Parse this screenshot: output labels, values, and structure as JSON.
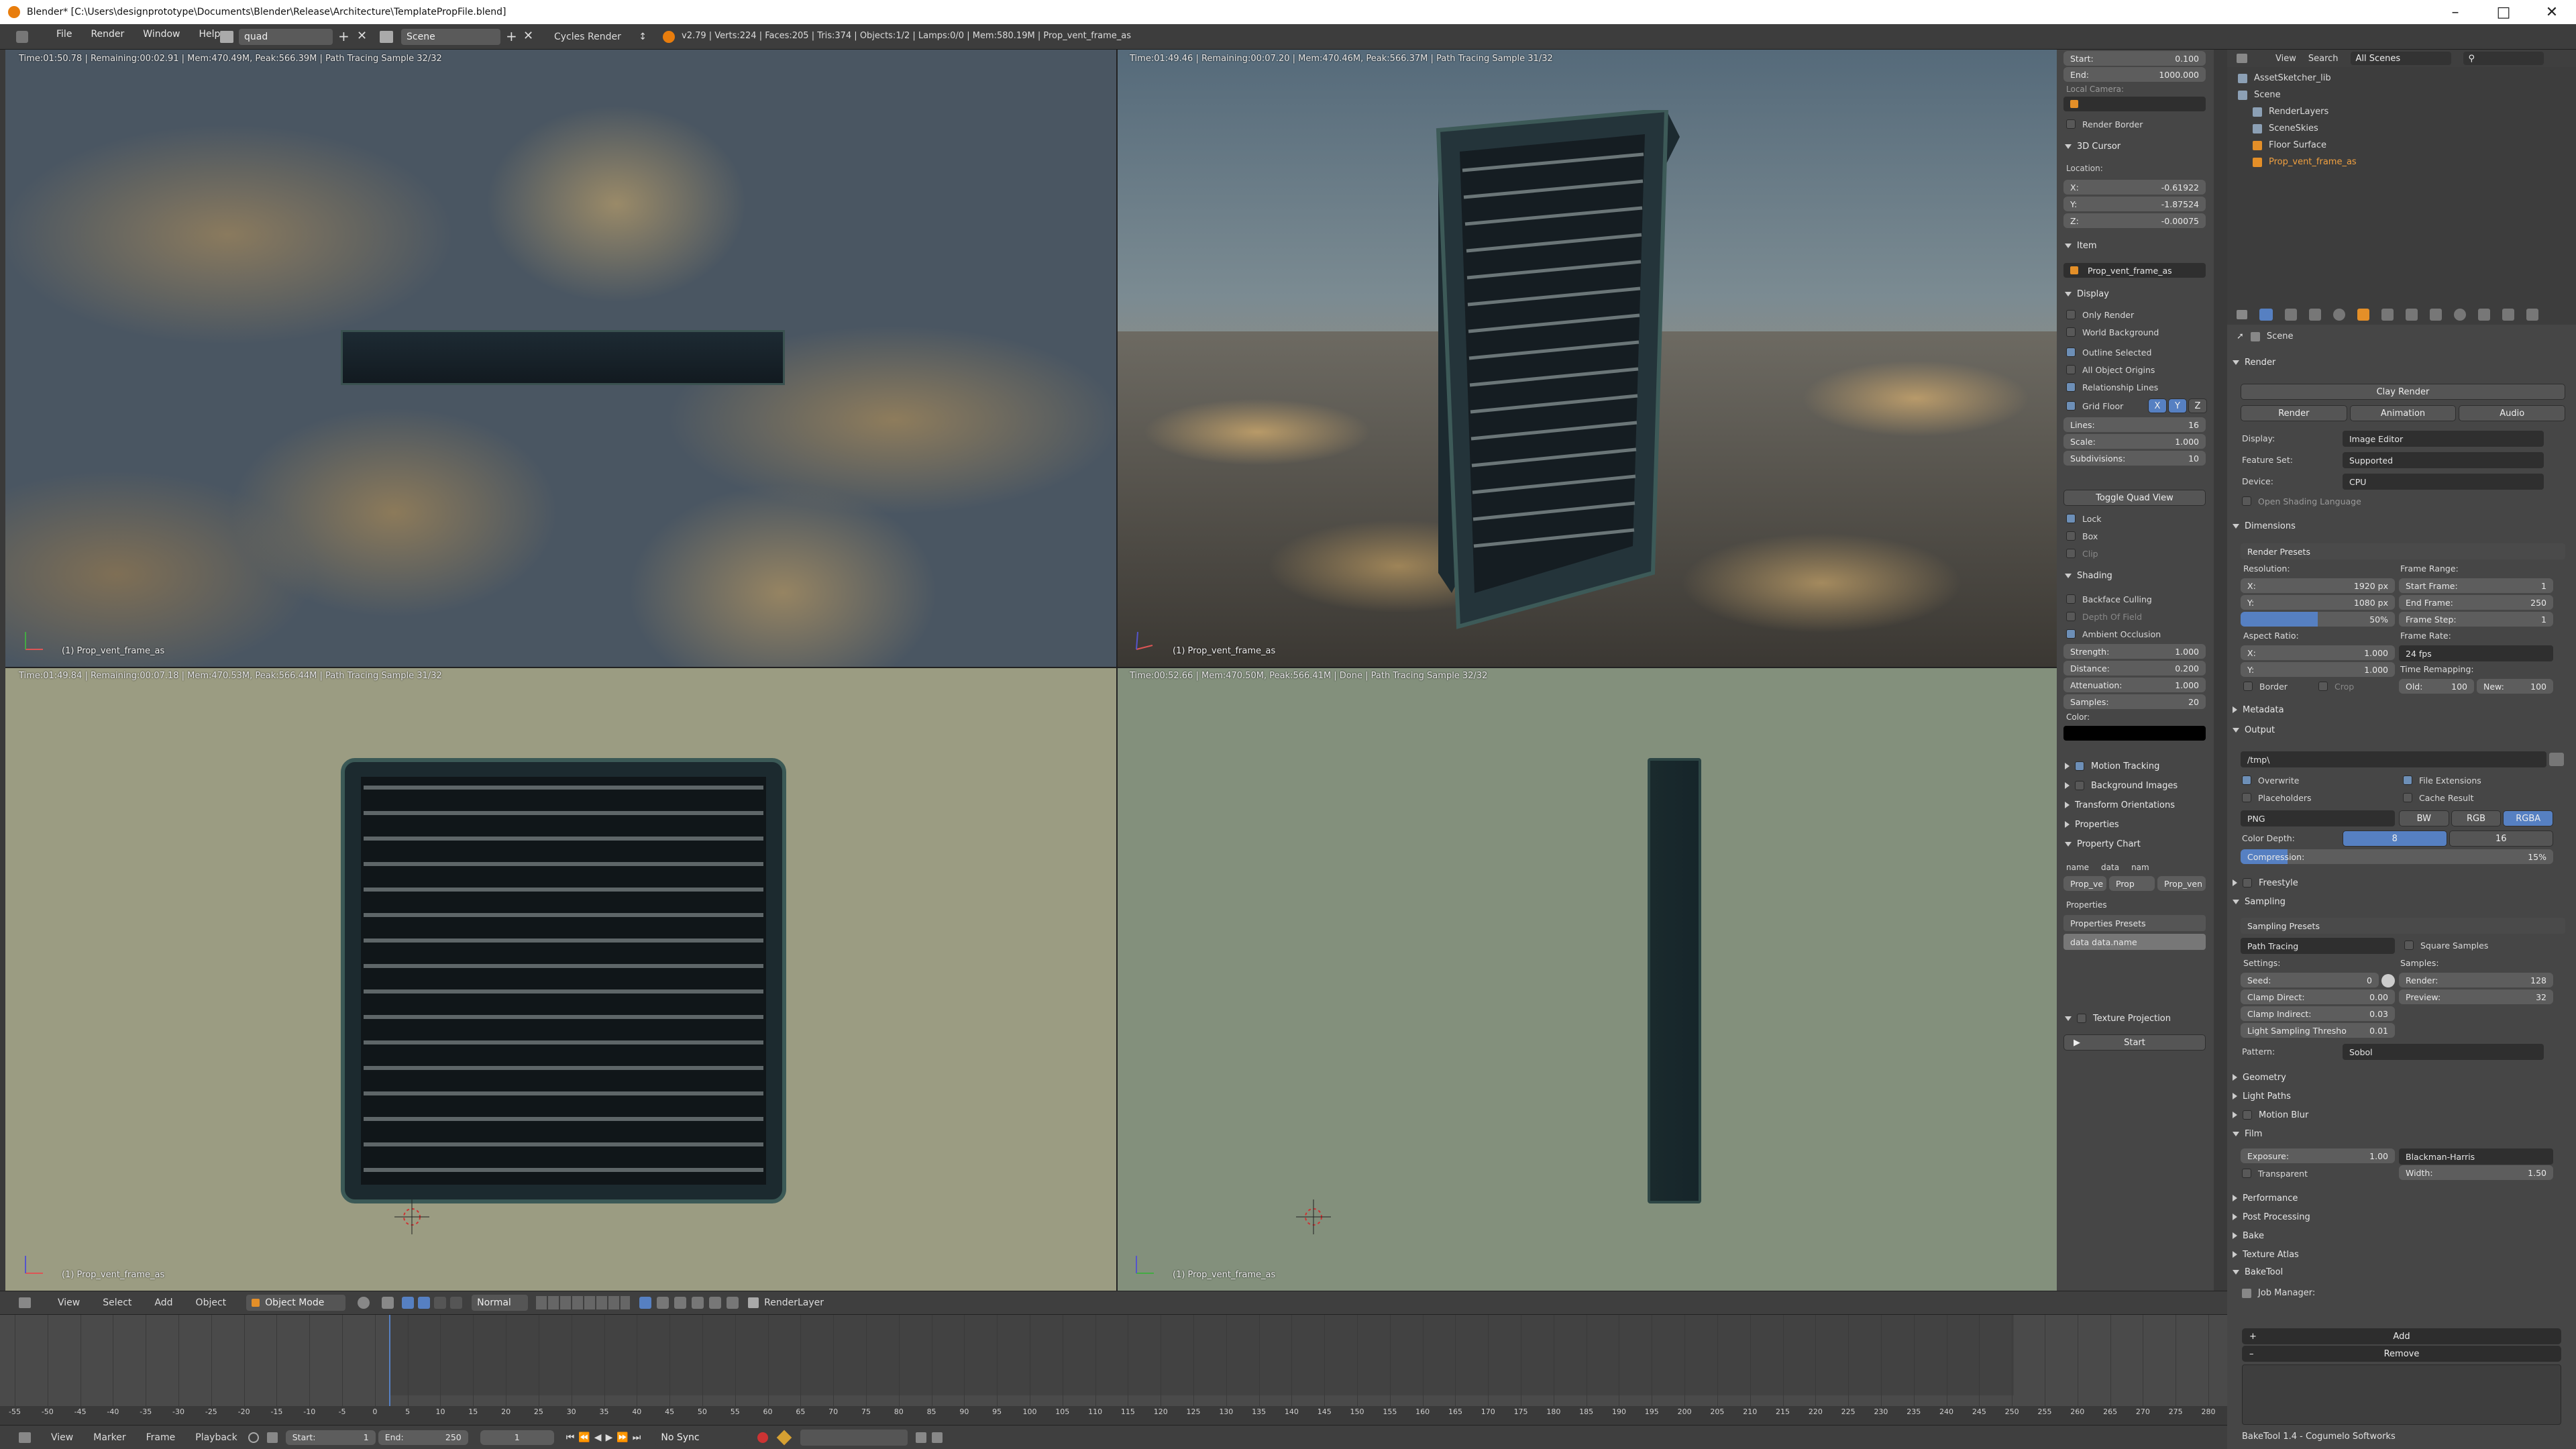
{
  "window": {
    "title": "Blender* [C:\\Users\\designprototype\\Documents\\Blender\\Release\\Architecture\\TemplatePropFile.blend]",
    "controls": [
      "minimize-icon",
      "maximize-icon",
      "close-icon"
    ]
  },
  "infobar": {
    "menus": [
      "File",
      "Render",
      "Window",
      "Help"
    ],
    "layout": "quad",
    "scene": "Scene",
    "engine": "Cycles Render",
    "stats": "v2.79 | Verts:224 | Faces:205 | Tris:374 | Objects:1/2 | Lamps:0/0 | Mem:580.19M | Prop_vent_frame_as"
  },
  "viewports": [
    {
      "status": "Time:01:50.78 | Remaining:00:02.91 | Mem:470.49M, Peak:566.39M | Path Tracing Sample 32/32",
      "label": "(1) Prop_vent_frame_as"
    },
    {
      "status": "Time:01:49.46 | Remaining:00:07.20 | Mem:470.46M, Peak:566.37M | Path Tracing Sample 31/32",
      "label": "(1) Prop_vent_frame_as"
    },
    {
      "status": "Time:01:49.84 | Remaining:00:07.18 | Mem:470.53M, Peak:566.44M | Path Tracing Sample 31/32",
      "label": "(1) Prop_vent_frame_as"
    },
    {
      "status": "Time:00:52.66 | Mem:470.50M, Peak:566.41M | Done | Path Tracing Sample 32/32",
      "label": "(1) Prop_vent_frame_as"
    }
  ],
  "nprops": {
    "start_label": "Start:",
    "start_val": "0.100",
    "end_label": "End:",
    "end_val": "1000.000",
    "local_camera": "Local Camera:",
    "render_border": "Render Border",
    "cursor_head": "3D Cursor",
    "location": "Location:",
    "cx": "X:",
    "cx_val": "-0.61922",
    "cy": "Y:",
    "cy_val": "-1.87524",
    "cz": "Z:",
    "cz_val": "-0.00075",
    "item_head": "Item",
    "item_name": "Prop_vent_frame_as",
    "display_head": "Display",
    "only_render": "Only Render",
    "world_bg": "World Background",
    "outline_sel": "Outline Selected",
    "all_origins": "All Object Origins",
    "rel_lines": "Relationship Lines",
    "grid_floor": "Grid Floor",
    "gx": "X",
    "gy": "Y",
    "gz": "Z",
    "lines": "Lines:",
    "lines_val": "16",
    "scale": "Scale:",
    "scale_val": "1.000",
    "subdiv": "Subdivisions:",
    "subdiv_val": "10",
    "toggle_quad": "Toggle Quad View",
    "lock": "Lock",
    "box": "Box",
    "clip": "Clip",
    "shading_head": "Shading",
    "backface": "Backface Culling",
    "dof": "Depth Of Field",
    "ao": "Ambient Occlusion",
    "strength": "Strength:",
    "strength_val": "1.000",
    "distance": "Distance:",
    "distance_val": "0.200",
    "attenuation": "Attenuation:",
    "attenuation_val": "1.000",
    "samples": "Samples:",
    "samples_val": "20",
    "color": "Color:",
    "motion_tracking": "Motion Tracking",
    "bg_images": "Background Images",
    "transform_orient": "Transform Orientations",
    "properties": "Properties",
    "prop_chart": "Property Chart",
    "pc_name": "name",
    "pc_data": "data",
    "pc_nam": "nam",
    "pc_v1": "Prop_ve",
    "pc_v2": "Prop",
    "pc_v3": "Prop_ven",
    "properties2": "Properties",
    "prop_presets": "Properties Presets",
    "data_name": "data data.name",
    "tex_proj": "Texture Projection",
    "start_btn": "Start"
  },
  "outliner": {
    "view": "View",
    "search": "Search",
    "scenes": "All Scenes",
    "items": [
      {
        "label": "AssetSketcher_lib",
        "indent": 0,
        "icon": "library-icon"
      },
      {
        "label": "Scene",
        "indent": 0,
        "icon": "scene-icon"
      },
      {
        "label": "RenderLayers",
        "indent": 1,
        "icon": "renderlayers-icon"
      },
      {
        "label": "SceneSkies",
        "indent": 1,
        "icon": "world-icon"
      },
      {
        "label": "Floor Surface",
        "indent": 1,
        "icon": "mesh-icon"
      },
      {
        "label": "Prop_vent_frame_as",
        "indent": 1,
        "icon": "mesh-icon"
      }
    ]
  },
  "props": {
    "scene": "Scene",
    "render_head": "Render",
    "clay_render": "Clay Render",
    "render_btn": "Render",
    "animation_btn": "Animation",
    "audio_btn": "Audio",
    "display": "Display:",
    "display_val": "Image Editor",
    "feature_set": "Feature Set:",
    "feature_set_val": "Supported",
    "device": "Device:",
    "device_val": "CPU",
    "osl": "Open Shading Language",
    "dimensions_head": "Dimensions",
    "render_presets": "Render Presets",
    "resolution": "Resolution:",
    "rx": "X:",
    "rx_val": "1920 px",
    "ry": "Y:",
    "ry_val": "1080 px",
    "rpct": "50%",
    "frame_range": "Frame Range:",
    "sf": "Start Frame:",
    "sf_val": "1",
    "ef": "End Frame:",
    "ef_val": "250",
    "fs": "Frame Step:",
    "fs_val": "1",
    "aspect": "Aspect Ratio:",
    "ax": "X:",
    "ax_val": "1.000",
    "ay": "Y:",
    "ay_val": "1.000",
    "frame_rate": "Frame Rate:",
    "frame_rate_val": "24 fps",
    "time_remap": "Time Remapping:",
    "old": "Old:",
    "old_val": "100",
    "new": "New:",
    "new_val": "100",
    "border": "Border",
    "crop": "Crop",
    "metadata": "Metadata",
    "output": "Output",
    "out_path": "/tmp\\",
    "overwrite": "Overwrite",
    "file_ext": "File Extensions",
    "placeholders": "Placeholders",
    "cache_result": "Cache Result",
    "format": "PNG",
    "bw": "BW",
    "rgb": "RGB",
    "rgba": "RGBA",
    "color_depth": "Color Depth:",
    "cd8": "8",
    "cd16": "16",
    "compression": "Compression:",
    "compression_val": "15%",
    "freestyle": "Freestyle",
    "sampling": "Sampling",
    "sampling_presets": "Sampling Presets",
    "path_tracing": "Path Tracing",
    "square_samples": "Square Samples",
    "settings": "Settings:",
    "samples": "Samples:",
    "seed": "Seed:",
    "seed_val": "0",
    "s_render": "Render:",
    "s_render_val": "128",
    "s_preview": "Preview:",
    "s_preview_val": "32",
    "clamp_direct": "Clamp Direct:",
    "clamp_direct_val": "0.00",
    "clamp_indirect": "Clamp Indirect:",
    "clamp_indirect_val": "0.03",
    "light_thresh": "Light Sampling Thresho",
    "light_thresh_val": "0.01",
    "pattern": "Pattern:",
    "pattern_val": "Sobol",
    "geometry": "Geometry",
    "light_paths": "Light Paths",
    "motion_blur": "Motion Blur",
    "film": "Film",
    "exposure": "Exposure:",
    "exposure_val": "1.00",
    "filter": "Blackman-Harris",
    "width": "Width:",
    "width_val": "1.50",
    "transparent": "Transparent",
    "performance": "Performance",
    "post_processing": "Post Processing",
    "bake": "Bake",
    "texture_atlas": "Texture Atlas",
    "baketool": "BakeTool",
    "job_manager": "Job Manager:",
    "add": "Add",
    "remove": "Remove",
    "footer": "BakeTool 1.4 - Cogumelo Softworks"
  },
  "view3d_header": {
    "view": "View",
    "select": "Select",
    "add": "Add",
    "object": "Object",
    "mode": "Object Mode",
    "pivot": "Normal",
    "layer": "RenderLayer"
  },
  "timeline": {
    "ticks": [
      "-55",
      "-50",
      "-45",
      "-40",
      "-35",
      "-30",
      "-25",
      "-20",
      "-15",
      "-10",
      "-5",
      "0",
      "5",
      "10",
      "15",
      "20",
      "25",
      "30",
      "35",
      "40",
      "45",
      "50",
      "55",
      "60",
      "65",
      "70",
      "75",
      "80",
      "85",
      "90",
      "95",
      "100",
      "105",
      "110",
      "115",
      "120",
      "125",
      "130",
      "135",
      "140",
      "145",
      "150",
      "155",
      "160",
      "165",
      "170",
      "175",
      "180",
      "185",
      "190",
      "195",
      "200",
      "205",
      "210",
      "215",
      "220",
      "225",
      "230",
      "235",
      "240",
      "245",
      "250",
      "255",
      "260",
      "265",
      "270",
      "275",
      "280"
    ],
    "view": "View",
    "marker": "Marker",
    "frame": "Frame",
    "playback": "Playback",
    "start": "Start:",
    "start_val": "1",
    "end": "End:",
    "end_val": "250",
    "current": "1",
    "sync": "No Sync"
  }
}
